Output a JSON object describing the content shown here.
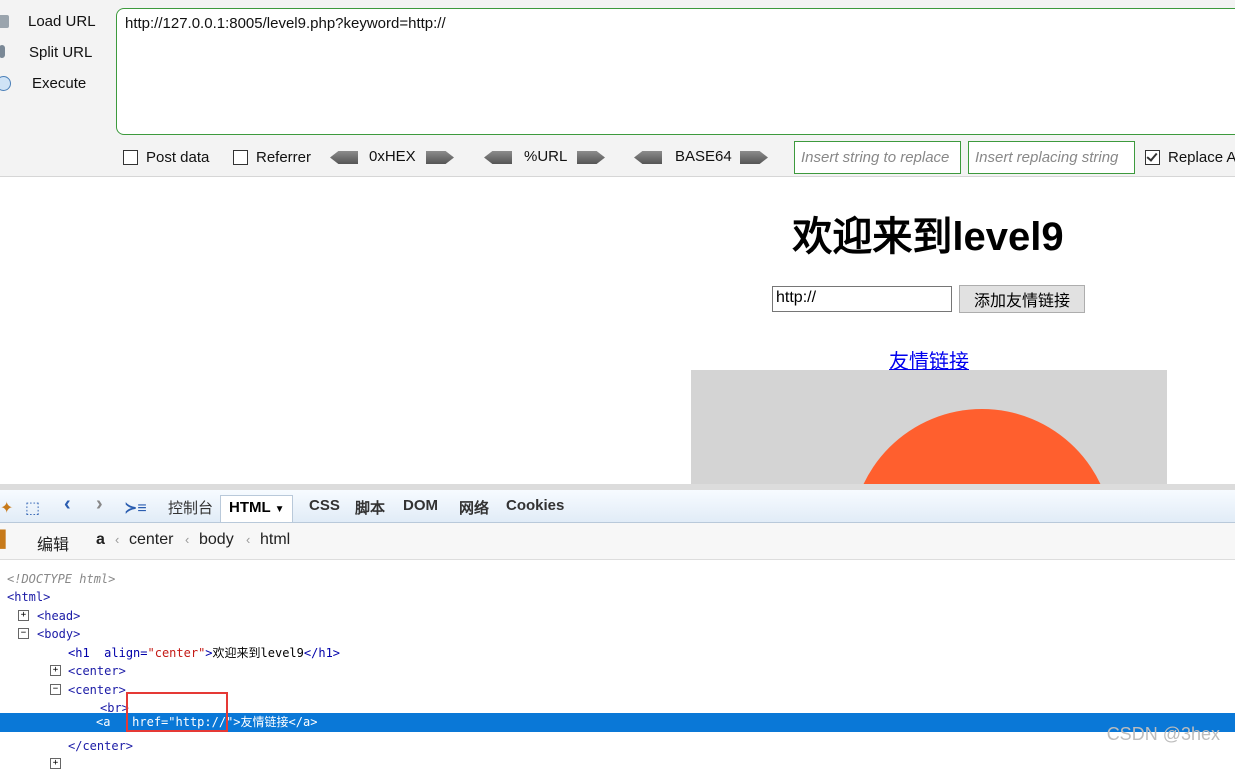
{
  "hackbar": {
    "load_url": "Load URL",
    "split_url": "Split URL",
    "execute": "Execute",
    "url_value": "http://127.0.0.1:8005/level9.php?keyword=http://",
    "post_data": "Post data",
    "referrer": "Referrer",
    "hex": "0xHEX",
    "url_enc": "%URL",
    "base64": "BASE64",
    "replace_placeholder": "Insert string to replace",
    "replacing_placeholder": "Insert replacing string",
    "replace_all": "Replace All",
    "accent": "#3d9a3d"
  },
  "page": {
    "title": "欢迎来到level9",
    "keyword_value": "http://",
    "add_button": "添加友情链接",
    "link_text": "友情链接"
  },
  "devtools": {
    "tabs": [
      "控制台",
      "HTML",
      "CSS",
      "脚本",
      "DOM",
      "网络",
      "Cookies"
    ],
    "edit": "编辑",
    "breadcrumb": [
      "a",
      "center",
      "body",
      "html"
    ],
    "tree": {
      "doctype": "<!DOCTYPE html>",
      "html_open": "<html>",
      "head": "<head>",
      "body": "<body>",
      "h1_open": "<h1",
      "h1_attr": "align=",
      "h1_val": "\"center\"",
      "h1_text": "欢迎来到level9",
      "h1_close": "</h1>",
      "center1": "<center>",
      "center2": "<center>",
      "br": "<br>",
      "a_open": "<a",
      "a_attr": "href=",
      "a_val": "\"http://\"",
      "a_close_bracket": ">",
      "a_text": "友情链接",
      "a_close": "</a>",
      "center_close": "</center>"
    },
    "highlight_color": "#0a78d7"
  },
  "watermark": "CSDN @3hex"
}
